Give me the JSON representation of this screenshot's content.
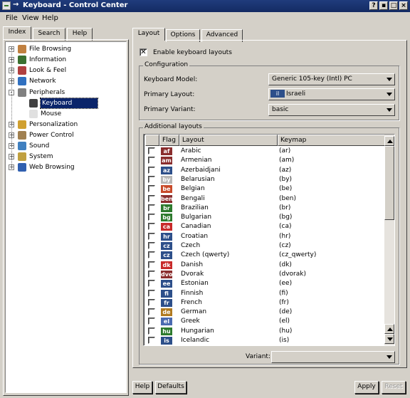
{
  "window": {
    "title": "Keyboard - Control Center",
    "buttons": [
      "?",
      "▪",
      "□",
      "×"
    ]
  },
  "menubar": {
    "file": "File",
    "view": "View",
    "help": "Help"
  },
  "left_tabs": [
    "Index",
    "Search",
    "Help"
  ],
  "tree": [
    {
      "label": "File Browsing",
      "expander": "+",
      "icon": "file-browsing-icon",
      "color": "#c08040"
    },
    {
      "label": "Information",
      "expander": "+",
      "icon": "information-icon",
      "color": "#3a7030"
    },
    {
      "label": "Look & Feel",
      "expander": "+",
      "icon": "look-feel-icon",
      "color": "#b04040"
    },
    {
      "label": "Network",
      "expander": "+",
      "icon": "network-icon",
      "color": "#3070c0"
    },
    {
      "label": "Peripherals",
      "expander": "-",
      "icon": "peripherals-icon",
      "color": "#808080"
    },
    {
      "label": "Keyboard",
      "expander": "",
      "icon": "keyboard-icon",
      "color": "#404040",
      "selected": true
    },
    {
      "label": "Mouse",
      "expander": "",
      "icon": "mouse-icon",
      "color": "#e0e0e0"
    },
    {
      "label": "Personalization",
      "expander": "+",
      "icon": "personalization-icon",
      "color": "#d0a030"
    },
    {
      "label": "Power Control",
      "expander": "+",
      "icon": "power-control-icon",
      "color": "#a08050"
    },
    {
      "label": "Sound",
      "expander": "+",
      "icon": "sound-icon",
      "color": "#4080c0"
    },
    {
      "label": "System",
      "expander": "+",
      "icon": "system-icon",
      "color": "#c0a040"
    },
    {
      "label": "Web Browsing",
      "expander": "+",
      "icon": "web-browsing-icon",
      "color": "#3060b0"
    }
  ],
  "right_tabs": [
    "Layout",
    "Options",
    "Advanced"
  ],
  "enable": {
    "label": "Enable keyboard layouts",
    "checked": "✕"
  },
  "config": {
    "title": "Configuration",
    "model_label": "Keyboard Model:",
    "model_value": "Generic 105-key (Intl) PC",
    "primary_label": "Primary Layout:",
    "primary_value": "Israeli",
    "primary_flag": "il",
    "variant_label": "Primary Variant:",
    "variant_value": "basic"
  },
  "additional": {
    "title": "Additional layouts",
    "columns": [
      "Flag",
      "Layout",
      "Keymap"
    ],
    "rows": [
      {
        "flag": "af",
        "color": "#8a2d2d",
        "layout": "Arabic",
        "keymap": "(ar)"
      },
      {
        "flag": "am",
        "color": "#8a2d2d",
        "layout": "Armenian",
        "keymap": "(am)"
      },
      {
        "flag": "az",
        "color": "#2d4f8a",
        "layout": "Azerbaidjani",
        "keymap": "(az)"
      },
      {
        "flag": "by",
        "color": "#b8b8b8",
        "layout": "Belarusian",
        "keymap": "(by)"
      },
      {
        "flag": "be",
        "color": "#c84a2a",
        "layout": "Belgian",
        "keymap": "(be)"
      },
      {
        "flag": "ben",
        "color": "#8a2d2d",
        "layout": "Bengali",
        "keymap": "(ben)"
      },
      {
        "flag": "br",
        "color": "#2d7a2d",
        "layout": "Brazilian",
        "keymap": "(br)"
      },
      {
        "flag": "bg",
        "color": "#2d7a2d",
        "layout": "Bulgarian",
        "keymap": "(bg)"
      },
      {
        "flag": "ca",
        "color": "#c82a2a",
        "layout": "Canadian",
        "keymap": "(ca)"
      },
      {
        "flag": "hr",
        "color": "#2d4f8a",
        "layout": "Croatian",
        "keymap": "(hr)"
      },
      {
        "flag": "cz",
        "color": "#2d4f8a",
        "layout": "Czech",
        "keymap": "(cz)"
      },
      {
        "flag": "cz",
        "color": "#2d4f8a",
        "layout": "Czech (qwerty)",
        "keymap": "(cz_qwerty)"
      },
      {
        "flag": "dk",
        "color": "#c82a2a",
        "layout": "Danish",
        "keymap": "(dk)"
      },
      {
        "flag": "dvo",
        "color": "#8a2d2d",
        "layout": "Dvorak",
        "keymap": "(dvorak)"
      },
      {
        "flag": "ee",
        "color": "#2d4f8a",
        "layout": "Estonian",
        "keymap": "(ee)"
      },
      {
        "flag": "fi",
        "color": "#2d4f8a",
        "layout": "Finnish",
        "keymap": "(fi)"
      },
      {
        "flag": "fr",
        "color": "#2d4f8a",
        "layout": "French",
        "keymap": "(fr)"
      },
      {
        "flag": "de",
        "color": "#b07a20",
        "layout": "German",
        "keymap": "(de)"
      },
      {
        "flag": "el",
        "color": "#4a6ab0",
        "layout": "Greek",
        "keymap": "(el)"
      },
      {
        "flag": "hu",
        "color": "#2d7a2d",
        "layout": "Hungarian",
        "keymap": "(hu)"
      },
      {
        "flag": "is",
        "color": "#2d4f8a",
        "layout": "Icelandic",
        "keymap": "(is)"
      }
    ]
  },
  "variant": {
    "label": "Variant:",
    "value": ""
  },
  "bottom": {
    "help": "Help",
    "defaults": "Defaults",
    "apply": "Apply",
    "reset": "Reset"
  }
}
